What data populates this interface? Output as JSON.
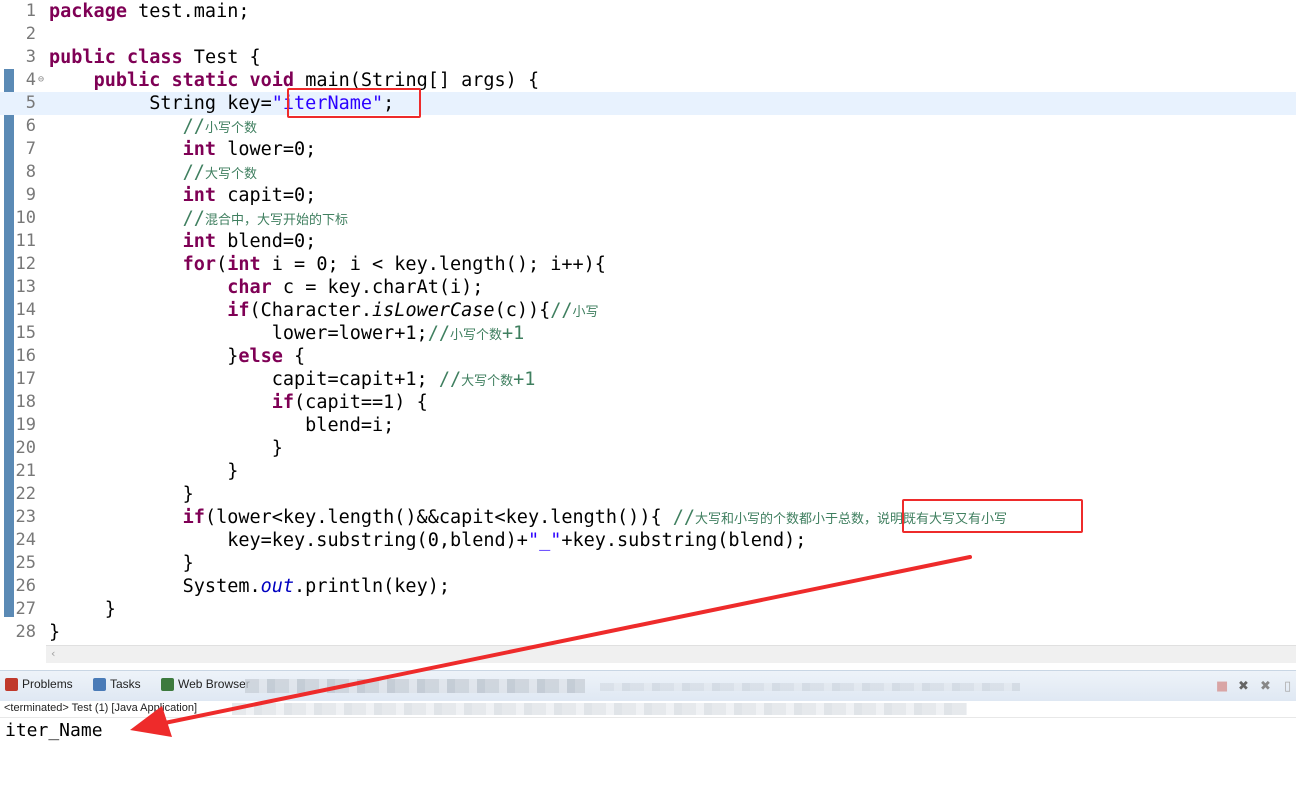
{
  "editor": {
    "lines": [
      {
        "n": "1",
        "html": "<span class=\"k\">package</span> test.main;"
      },
      {
        "n": "2",
        "html": ""
      },
      {
        "n": "3",
        "html": "<span class=\"k\">public</span> <span class=\"k\">class</span> Test {"
      },
      {
        "n": "4",
        "html": "    <span class=\"k\">public</span> <span class=\"k\">static</span> <span class=\"k\">void</span> main(String[] args) {",
        "fold": "⊖"
      },
      {
        "n": "5",
        "html": "         String key=<span class=\"s\">\"iterName\"</span>;",
        "hl": true
      },
      {
        "n": "6",
        "html": "            <span class=\"cn\">//</span><span class=\"c\">小写个数</span>"
      },
      {
        "n": "7",
        "html": "            <span class=\"k\">int</span> lower=0;"
      },
      {
        "n": "8",
        "html": "            <span class=\"cn\">//</span><span class=\"c\">大写个数</span>"
      },
      {
        "n": "9",
        "html": "            <span class=\"k\">int</span> capit=0;"
      },
      {
        "n": "10",
        "html": "            <span class=\"cn\">//</span><span class=\"c\">混合中，大写开始的下标</span>"
      },
      {
        "n": "11",
        "html": "            <span class=\"k\">int</span> blend=0;"
      },
      {
        "n": "12",
        "html": "            <span class=\"k\">for</span>(<span class=\"k\">int</span> i = 0; i &lt; key.length(); i++){"
      },
      {
        "n": "13",
        "html": "                <span class=\"k\">char</span> c = key.charAt(i);"
      },
      {
        "n": "14",
        "html": "                <span class=\"k\">if</span>(Character.<span class=\"it\">isLowerCase</span>(c)){<span class=\"cn\">//</span><span class=\"c\">小写</span>"
      },
      {
        "n": "15",
        "html": "                    lower=lower+1;<span class=\"cn\">//</span><span class=\"c\">小写个数</span><span class=\"cn\">+1</span>"
      },
      {
        "n": "16",
        "html": "                }<span class=\"k\">else</span> {"
      },
      {
        "n": "17",
        "html": "                    capit=capit+1; <span class=\"cn\">//</span><span class=\"c\">大写个数</span><span class=\"cn\">+1</span>"
      },
      {
        "n": "18",
        "html": "                    <span class=\"k\">if</span>(capit==1) {"
      },
      {
        "n": "19",
        "html": "                       blend=i;"
      },
      {
        "n": "20",
        "html": "                    }"
      },
      {
        "n": "21",
        "html": "                }"
      },
      {
        "n": "22",
        "html": "            }"
      },
      {
        "n": "23",
        "html": "            <span class=\"k\">if</span>(lower&lt;key.length()&amp;&amp;capit&lt;key.length()){ <span class=\"cn\">//</span><span class=\"c\">大写和小写的个数都小于总数，说明既有大写又有小写</span>"
      },
      {
        "n": "24",
        "html": "                key=key.substring(0,blend)+<span class=\"s\">\"_\"</span>+key.substring(blend);"
      },
      {
        "n": "25",
        "html": "            }"
      },
      {
        "n": "26",
        "html": "            System.<span class=\"fld\">out</span>.println(key);"
      },
      {
        "n": "27",
        "html": "     }"
      },
      {
        "n": "28",
        "html": "}"
      }
    ]
  },
  "scroll": {
    "left_arrow": "‹"
  },
  "tabs": [
    {
      "label": "Problems",
      "icon": "problems-icon",
      "color": "#c0392b"
    },
    {
      "label": "Tasks",
      "icon": "tasks-icon",
      "color": "#4a7bb7"
    },
    {
      "label": "Web Browser",
      "icon": "web-browser-icon",
      "color": "#3d7a3d"
    }
  ],
  "toolbar": {
    "stop": "■",
    "remove": "✖",
    "remove_all": "✖"
  },
  "status": {
    "text": "<terminated> Test (1) [Java Application]"
  },
  "console": {
    "output": "iter_Name"
  }
}
